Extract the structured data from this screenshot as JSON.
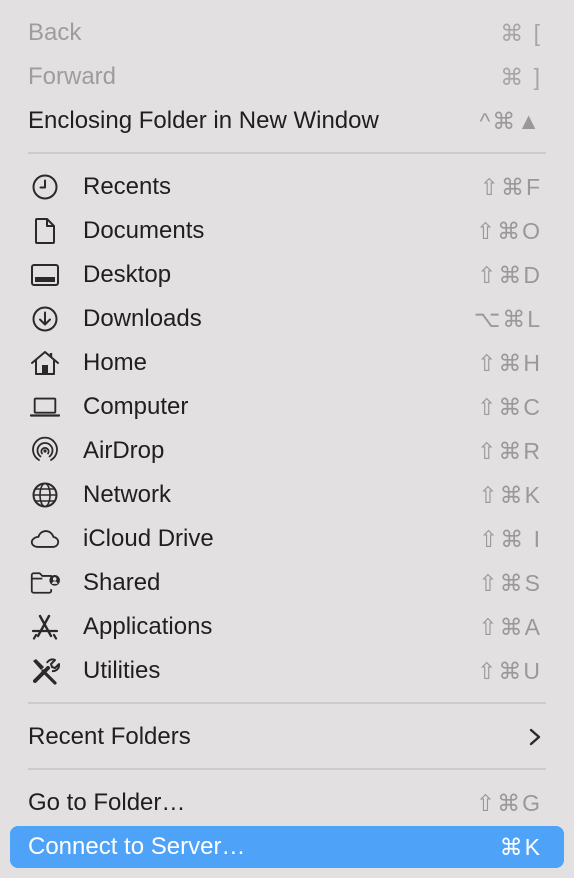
{
  "menu": {
    "top_items": [
      {
        "label": "Back",
        "shortcut": "⌘ [",
        "disabled": true
      },
      {
        "label": "Forward",
        "shortcut": "⌘ ]",
        "disabled": true
      },
      {
        "label": "Enclosing Folder in New Window",
        "shortcut": "^⌘▲",
        "disabled": false
      }
    ],
    "places": [
      {
        "label": "Recents",
        "shortcut": "⇧⌘F",
        "icon": "clock-icon"
      },
      {
        "label": "Documents",
        "shortcut": "⇧⌘O",
        "icon": "document-icon"
      },
      {
        "label": "Desktop",
        "shortcut": "⇧⌘D",
        "icon": "desktop-icon"
      },
      {
        "label": "Downloads",
        "shortcut": "⌥⌘L",
        "icon": "download-icon"
      },
      {
        "label": "Home",
        "shortcut": "⇧⌘H",
        "icon": "home-icon"
      },
      {
        "label": "Computer",
        "shortcut": "⇧⌘C",
        "icon": "laptop-icon"
      },
      {
        "label": "AirDrop",
        "shortcut": "⇧⌘R",
        "icon": "airdrop-icon"
      },
      {
        "label": "Network",
        "shortcut": "⇧⌘K",
        "icon": "globe-icon"
      },
      {
        "label": "iCloud Drive",
        "shortcut": "⇧⌘ I",
        "icon": "cloud-icon"
      },
      {
        "label": "Shared",
        "shortcut": "⇧⌘S",
        "icon": "shared-folder-icon"
      },
      {
        "label": "Applications",
        "shortcut": "⇧⌘A",
        "icon": "applications-icon"
      },
      {
        "label": "Utilities",
        "shortcut": "⇧⌘U",
        "icon": "utilities-icon"
      }
    ],
    "recent_folders": {
      "label": "Recent Folders"
    },
    "go_to_folder": {
      "label": "Go to Folder…",
      "shortcut": "⇧⌘G"
    },
    "connect_to_server": {
      "label": "Connect to Server…",
      "shortcut": "⌘K"
    }
  },
  "colors": {
    "background": "#e3e0e2",
    "highlight": "#4ea2f7",
    "text": "#1f1f1f",
    "disabled_text": "#9e9c9e",
    "shortcut_text": "#9a989a"
  }
}
